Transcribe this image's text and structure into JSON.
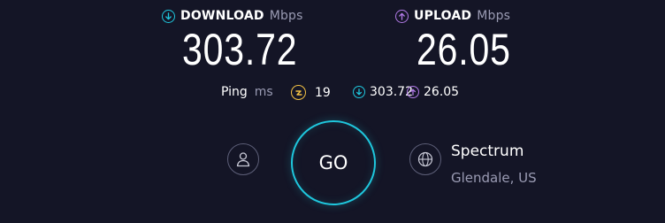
{
  "download": {
    "label": "DOWNLOAD",
    "unit": "Mbps",
    "value": "303.72",
    "color": "#1fc7dd"
  },
  "upload": {
    "label": "UPLOAD",
    "unit": "Mbps",
    "value": "26.05",
    "color": "#b17ae6"
  },
  "ping": {
    "label": "Ping",
    "unit": "ms",
    "idle_value": "19",
    "download_value": "303.72",
    "upload_value": "26.05",
    "idle_color": "#f3c245"
  },
  "go_button": {
    "label": "GO",
    "color": "#1fc7dd"
  },
  "isp": {
    "name": "Spectrum",
    "location": "Glendale, US"
  },
  "icons": {
    "download": "arrow-down-circle-icon",
    "upload": "arrow-up-circle-icon",
    "ping": "ping-idle-icon",
    "account": "user-icon",
    "isp": "globe-icon"
  }
}
